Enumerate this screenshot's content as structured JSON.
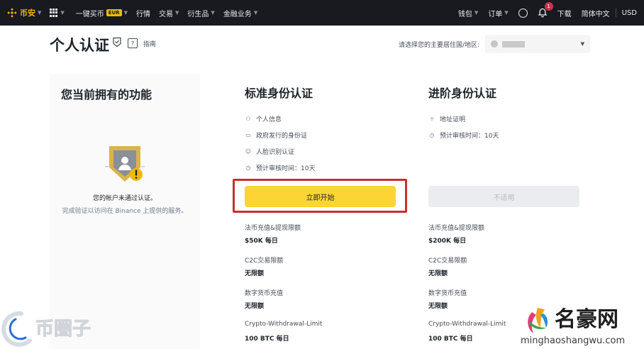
{
  "topbar": {
    "logo_text": "币安",
    "nav": [
      {
        "label": "一键买币",
        "badge": "EUR"
      },
      {
        "label": "行情"
      },
      {
        "label": "交易",
        "dropdown": true
      },
      {
        "label": "衍生品",
        "dropdown": true
      },
      {
        "label": "金融业务",
        "dropdown": true
      }
    ],
    "right": {
      "wallet": "钱包",
      "orders": "订单",
      "notif_count": "1",
      "download": "下载",
      "language": "简体中文",
      "currency": "USD"
    }
  },
  "header": {
    "title": "个人认证",
    "guide_label": "指南",
    "country_label": "请选择您的主要居住国/地区:"
  },
  "current": {
    "title": "您当前拥有的功能",
    "status": "您的帐户未通过认证。",
    "sub": "完成验证以访问在 Binance 上提供的服务。"
  },
  "standard": {
    "title": "标准身份认证",
    "features": [
      {
        "icon": "person-info-icon",
        "label": "个人信息"
      },
      {
        "icon": "id-card-icon",
        "label": "政府发行的身份证"
      },
      {
        "icon": "face-id-icon",
        "label": "人脸识别认证"
      },
      {
        "icon": "clock-icon",
        "label": "预计审核时间：10天"
      }
    ],
    "button": "立即开始",
    "limits": [
      {
        "label": "法币充值&提现限额",
        "value": "$50K 每日"
      },
      {
        "label": "C2C交易限额",
        "value": "无限额"
      },
      {
        "label": "数字货币充值",
        "value": "无限额"
      },
      {
        "label": "Crypto-Withdrawal-Limit",
        "value": "100 BTC 每日"
      }
    ]
  },
  "advanced": {
    "title": "进阶身份认证",
    "features": [
      {
        "icon": "location-icon",
        "label": "地址证明"
      },
      {
        "icon": "clock-icon",
        "label": "预计审核时间：10天"
      }
    ],
    "button": "不适用",
    "limits": [
      {
        "label": "法币充值&提现限额",
        "value": "$200K 每日"
      },
      {
        "label": "C2C交易限额",
        "value": "无限额"
      },
      {
        "label": "数字货币充值",
        "value": "无限额"
      },
      {
        "label": "Crypto-Withdrawal-Limit",
        "value": "100 BTC 每日"
      }
    ]
  },
  "watermarks": {
    "left": "币圈子",
    "right_main": "名豪网",
    "right_sub": "minghaoshangwu.com"
  },
  "colors": {
    "brand": "#F0B90B",
    "cta": "#FCD535",
    "highlight": "#C9302C"
  }
}
